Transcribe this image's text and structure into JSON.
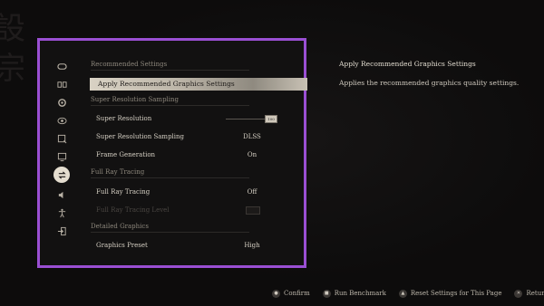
{
  "sidebar": {
    "icons": [
      {
        "name": "gamepad-icon"
      },
      {
        "name": "controls-icon"
      },
      {
        "name": "gear-icon"
      },
      {
        "name": "eye-icon"
      },
      {
        "name": "search-display-icon"
      },
      {
        "name": "monitor-icon"
      },
      {
        "name": "graphics-swap-icon",
        "active": true
      },
      {
        "name": "speaker-icon"
      },
      {
        "name": "accessibility-icon"
      },
      {
        "name": "exit-icon"
      }
    ]
  },
  "settings": {
    "section_recommended": "Recommended Settings",
    "apply_recommended": "Apply Recommended Graphics Settings",
    "section_ssaa": "Super Resolution Sampling",
    "super_resolution_label": "Super Resolution",
    "super_resolution_value": "100",
    "super_resolution_sampling_label": "Super Resolution Sampling",
    "super_resolution_sampling_value": "DLSS",
    "frame_generation_label": "Frame Generation",
    "frame_generation_value": "On",
    "section_ray": "Full Ray Tracing",
    "full_ray_tracing_label": "Full Ray Tracing",
    "full_ray_tracing_value": "Off",
    "full_ray_tracing_level_label": "Full Ray Tracing Level",
    "section_detailed": "Detailed Graphics",
    "graphics_preset_label": "Graphics Preset",
    "graphics_preset_value": "High"
  },
  "detail": {
    "title": "Apply Recommended Graphics Settings",
    "description": "Applies the recommended graphics quality settings."
  },
  "footer": {
    "confirm": "Confirm",
    "run_benchmark": "Run Benchmark",
    "reset_page": "Reset Settings for This Page",
    "return": "Return"
  },
  "colors": {
    "accent_border": "#9a4fd3",
    "highlight": "#d9d2c4"
  }
}
